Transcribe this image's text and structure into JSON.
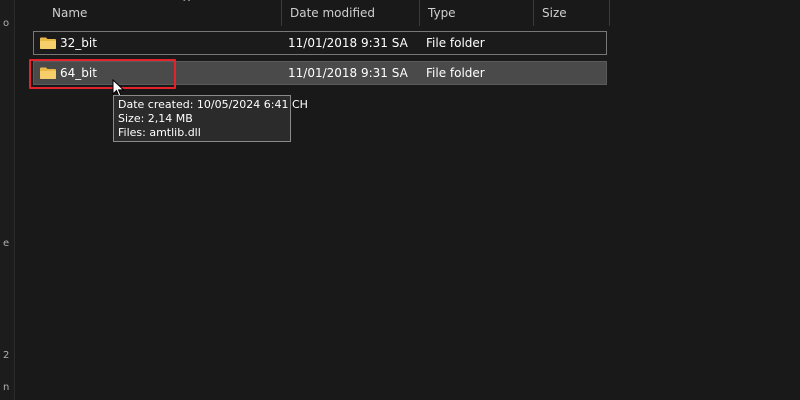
{
  "columns": {
    "name": "Name",
    "date_modified": "Date modified",
    "type": "Type",
    "size": "Size"
  },
  "files": [
    {
      "name": "32_bit",
      "date_modified": "11/01/2018 9:31 SA",
      "type": "File folder",
      "size": ""
    },
    {
      "name": "64_bit",
      "date_modified": "11/01/2018 9:31 SA",
      "type": "File folder",
      "size": ""
    }
  ],
  "tooltip": {
    "date_created": "Date created: 10/05/2024 6:41 CH",
    "size": "Size: 2,14 MB",
    "files": "Files: amtlib.dll"
  },
  "left_strip_glyphs": [
    "o",
    "e",
    "2",
    "n"
  ],
  "colors": {
    "background": "#191919",
    "selected_row": "#4a4a4a",
    "folder_yellow": "#f2c45a",
    "highlight_red": "#e3232c"
  }
}
